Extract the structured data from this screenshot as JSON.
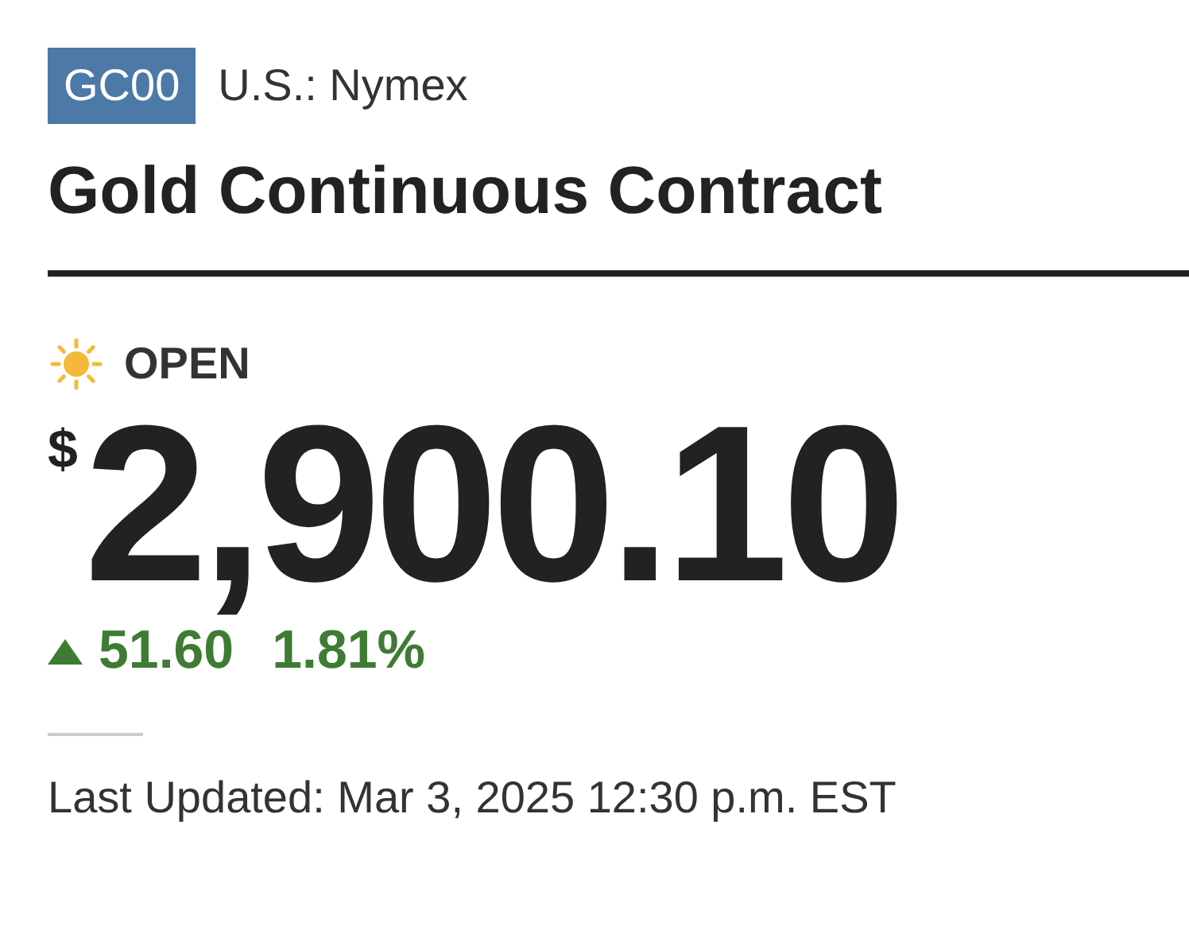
{
  "symbol": "GC00",
  "exchange": "U.S.: Nymex",
  "title": "Gold Continuous Contract",
  "market_status": {
    "label": "OPEN",
    "open": true
  },
  "price": {
    "currency": "$",
    "value": "2,900.10"
  },
  "change": {
    "up": true,
    "amount": "51.60",
    "percent": "1.81%"
  },
  "last_updated": "Last Updated: Mar 3, 2025 12:30 p.m. EST"
}
